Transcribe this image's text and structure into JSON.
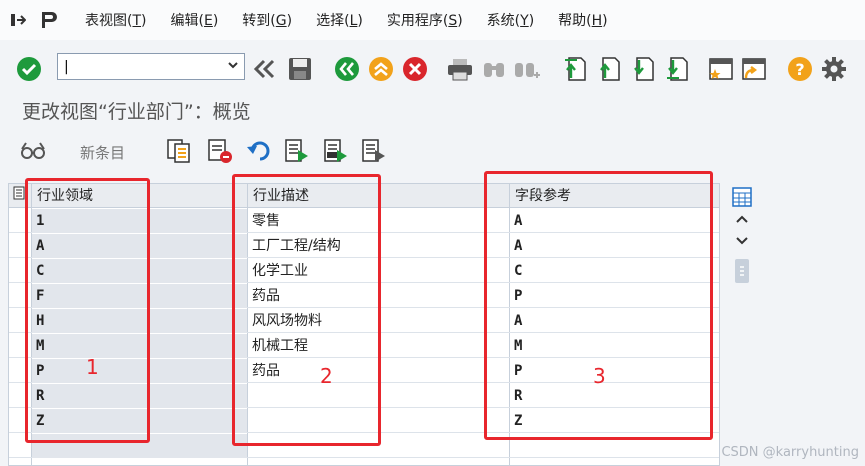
{
  "menu": {
    "items": [
      {
        "label": "表视图(",
        "key": "T",
        "end": ")"
      },
      {
        "label": "编辑(",
        "key": "E",
        "end": ")"
      },
      {
        "label": "转到(",
        "key": "G",
        "end": ")"
      },
      {
        "label": "选择(",
        "key": "L",
        "end": ")"
      },
      {
        "label": "实用程序(",
        "key": "S",
        "end": ")"
      },
      {
        "label": "系统(",
        "key": "Y",
        "end": ")"
      },
      {
        "label": "帮助(",
        "key": "H",
        "end": ")"
      }
    ]
  },
  "command_field": {
    "value": "|"
  },
  "title": "更改视图“行业部门”：概览",
  "app_toolbar": {
    "new_entries_label": "新条目"
  },
  "table": {
    "columns": [
      "行业领域",
      "行业描述",
      "字段参考"
    ],
    "rows": [
      {
        "key": "1",
        "desc": "零售",
        "ref": "A"
      },
      {
        "key": "A",
        "desc": "工厂工程/结构",
        "ref": "A"
      },
      {
        "key": "C",
        "desc": "化学工业",
        "ref": "C"
      },
      {
        "key": "F",
        "desc": "药品",
        "ref": "P"
      },
      {
        "key": "H",
        "desc": "风风场物料",
        "ref": "A"
      },
      {
        "key": "M",
        "desc": "机械工程",
        "ref": "M"
      },
      {
        "key": "P",
        "desc": "药品",
        "ref": "P"
      },
      {
        "key": "R",
        "desc": "",
        "ref": "R"
      },
      {
        "key": "Z",
        "desc": "",
        "ref": "Z"
      }
    ]
  },
  "annotations": [
    "1",
    "2",
    "3"
  ],
  "watermark": "CSDN @karryhunting",
  "colors": {
    "annotation": "#e8262d",
    "green": "#1e9a3c",
    "orange": "#f2a21a",
    "red": "#d9262c"
  }
}
